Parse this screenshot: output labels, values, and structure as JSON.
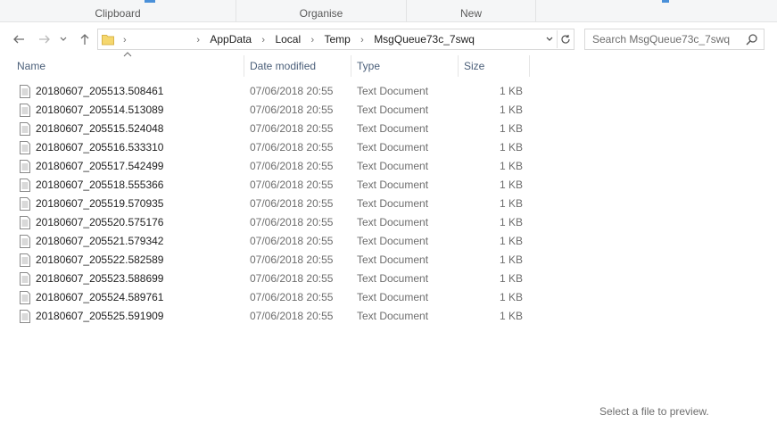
{
  "ribbon": {
    "groups": [
      "Clipboard",
      "Organise",
      "New"
    ]
  },
  "nav": {
    "back_icon": "back-arrow-icon",
    "forward_icon": "forward-arrow-icon",
    "recent_icon": "chevron-down-icon",
    "up_icon": "up-arrow-icon"
  },
  "address": {
    "crumbs": [
      "AppData",
      "Local",
      "Temp",
      "MsgQueue73c_7swq"
    ],
    "separator": "›",
    "dropdown_icon": "chevron-down-icon",
    "refresh_icon": "refresh-icon"
  },
  "search": {
    "placeholder": "Search MsgQueue73c_7swq",
    "value": ""
  },
  "columns": {
    "name": "Name",
    "date": "Date modified",
    "type": "Type",
    "size": "Size"
  },
  "files": [
    {
      "name": "20180607_205513.508461",
      "date": "07/06/2018 20:55",
      "type": "Text Document",
      "size": "1 KB"
    },
    {
      "name": "20180607_205514.513089",
      "date": "07/06/2018 20:55",
      "type": "Text Document",
      "size": "1 KB"
    },
    {
      "name": "20180607_205515.524048",
      "date": "07/06/2018 20:55",
      "type": "Text Document",
      "size": "1 KB"
    },
    {
      "name": "20180607_205516.533310",
      "date": "07/06/2018 20:55",
      "type": "Text Document",
      "size": "1 KB"
    },
    {
      "name": "20180607_205517.542499",
      "date": "07/06/2018 20:55",
      "type": "Text Document",
      "size": "1 KB"
    },
    {
      "name": "20180607_205518.555366",
      "date": "07/06/2018 20:55",
      "type": "Text Document",
      "size": "1 KB"
    },
    {
      "name": "20180607_205519.570935",
      "date": "07/06/2018 20:55",
      "type": "Text Document",
      "size": "1 KB"
    },
    {
      "name": "20180607_205520.575176",
      "date": "07/06/2018 20:55",
      "type": "Text Document",
      "size": "1 KB"
    },
    {
      "name": "20180607_205521.579342",
      "date": "07/06/2018 20:55",
      "type": "Text Document",
      "size": "1 KB"
    },
    {
      "name": "20180607_205522.582589",
      "date": "07/06/2018 20:55",
      "type": "Text Document",
      "size": "1 KB"
    },
    {
      "name": "20180607_205523.588699",
      "date": "07/06/2018 20:55",
      "type": "Text Document",
      "size": "1 KB"
    },
    {
      "name": "20180607_205524.589761",
      "date": "07/06/2018 20:55",
      "type": "Text Document",
      "size": "1 KB"
    },
    {
      "name": "20180607_205525.591909",
      "date": "07/06/2018 20:55",
      "type": "Text Document",
      "size": "1 KB"
    }
  ],
  "preview": {
    "message": "Select a file to preview."
  },
  "colors": {
    "folder": "#f5d76e",
    "accent": "#4a90d9",
    "header_text": "#4c607a"
  }
}
